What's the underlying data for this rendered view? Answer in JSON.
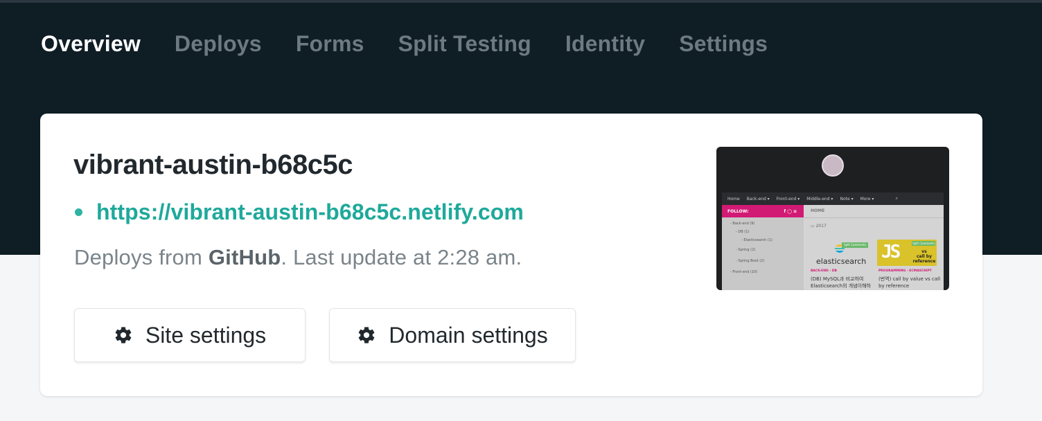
{
  "tabs": [
    {
      "label": "Overview",
      "active": true
    },
    {
      "label": "Deploys",
      "active": false
    },
    {
      "label": "Forms",
      "active": false
    },
    {
      "label": "Split Testing",
      "active": false
    },
    {
      "label": "Identity",
      "active": false
    },
    {
      "label": "Settings",
      "active": false
    }
  ],
  "site": {
    "name": "vibrant-austin-b68c5c",
    "url": "https://vibrant-austin-b68c5c.netlify.com",
    "deploy_prefix": "Deploys from ",
    "deploy_source": "GitHub",
    "deploy_suffix": ". Last update at 2:28 am."
  },
  "buttons": {
    "site_settings": "Site settings",
    "domain_settings": "Domain settings",
    "icon": "gear-icon"
  },
  "colors": {
    "header_bg": "#0f1d25",
    "accent": "#1ea99b",
    "status_dot": "#30b3a2"
  },
  "thumbnail": {
    "nav": [
      "Home",
      "Back-end ▾",
      "Front-end ▾",
      "Middle-end ▾",
      "Note ▾",
      "More ▾"
    ],
    "follow": "FOLLOW:",
    "social": "f  ◯  ≋",
    "sidebar": [
      "- Back-end (9)",
      "- DB (1)",
      "- Elasticsearch (1)",
      "- Spring (2)",
      "- Spring Boot (2)",
      "- Front-end (10)"
    ],
    "home": "HOME",
    "year": "▭ 2017",
    "es_badge": "Split Comments",
    "es_text": "elasticsearch",
    "js_badge": "Split Comments",
    "js_glyph": "JS",
    "js_caption_1": "vs",
    "js_caption_2": "call by reference",
    "cat1": "BACK-END  ›  DB",
    "cat2": "PROGRAMMING  ›  ECMASCRIPT",
    "post1": "(DB) MySQL과 비교하여 Elasticsearch의 개념이해하기",
    "post2": "(번역) call by value vs call by reference"
  }
}
